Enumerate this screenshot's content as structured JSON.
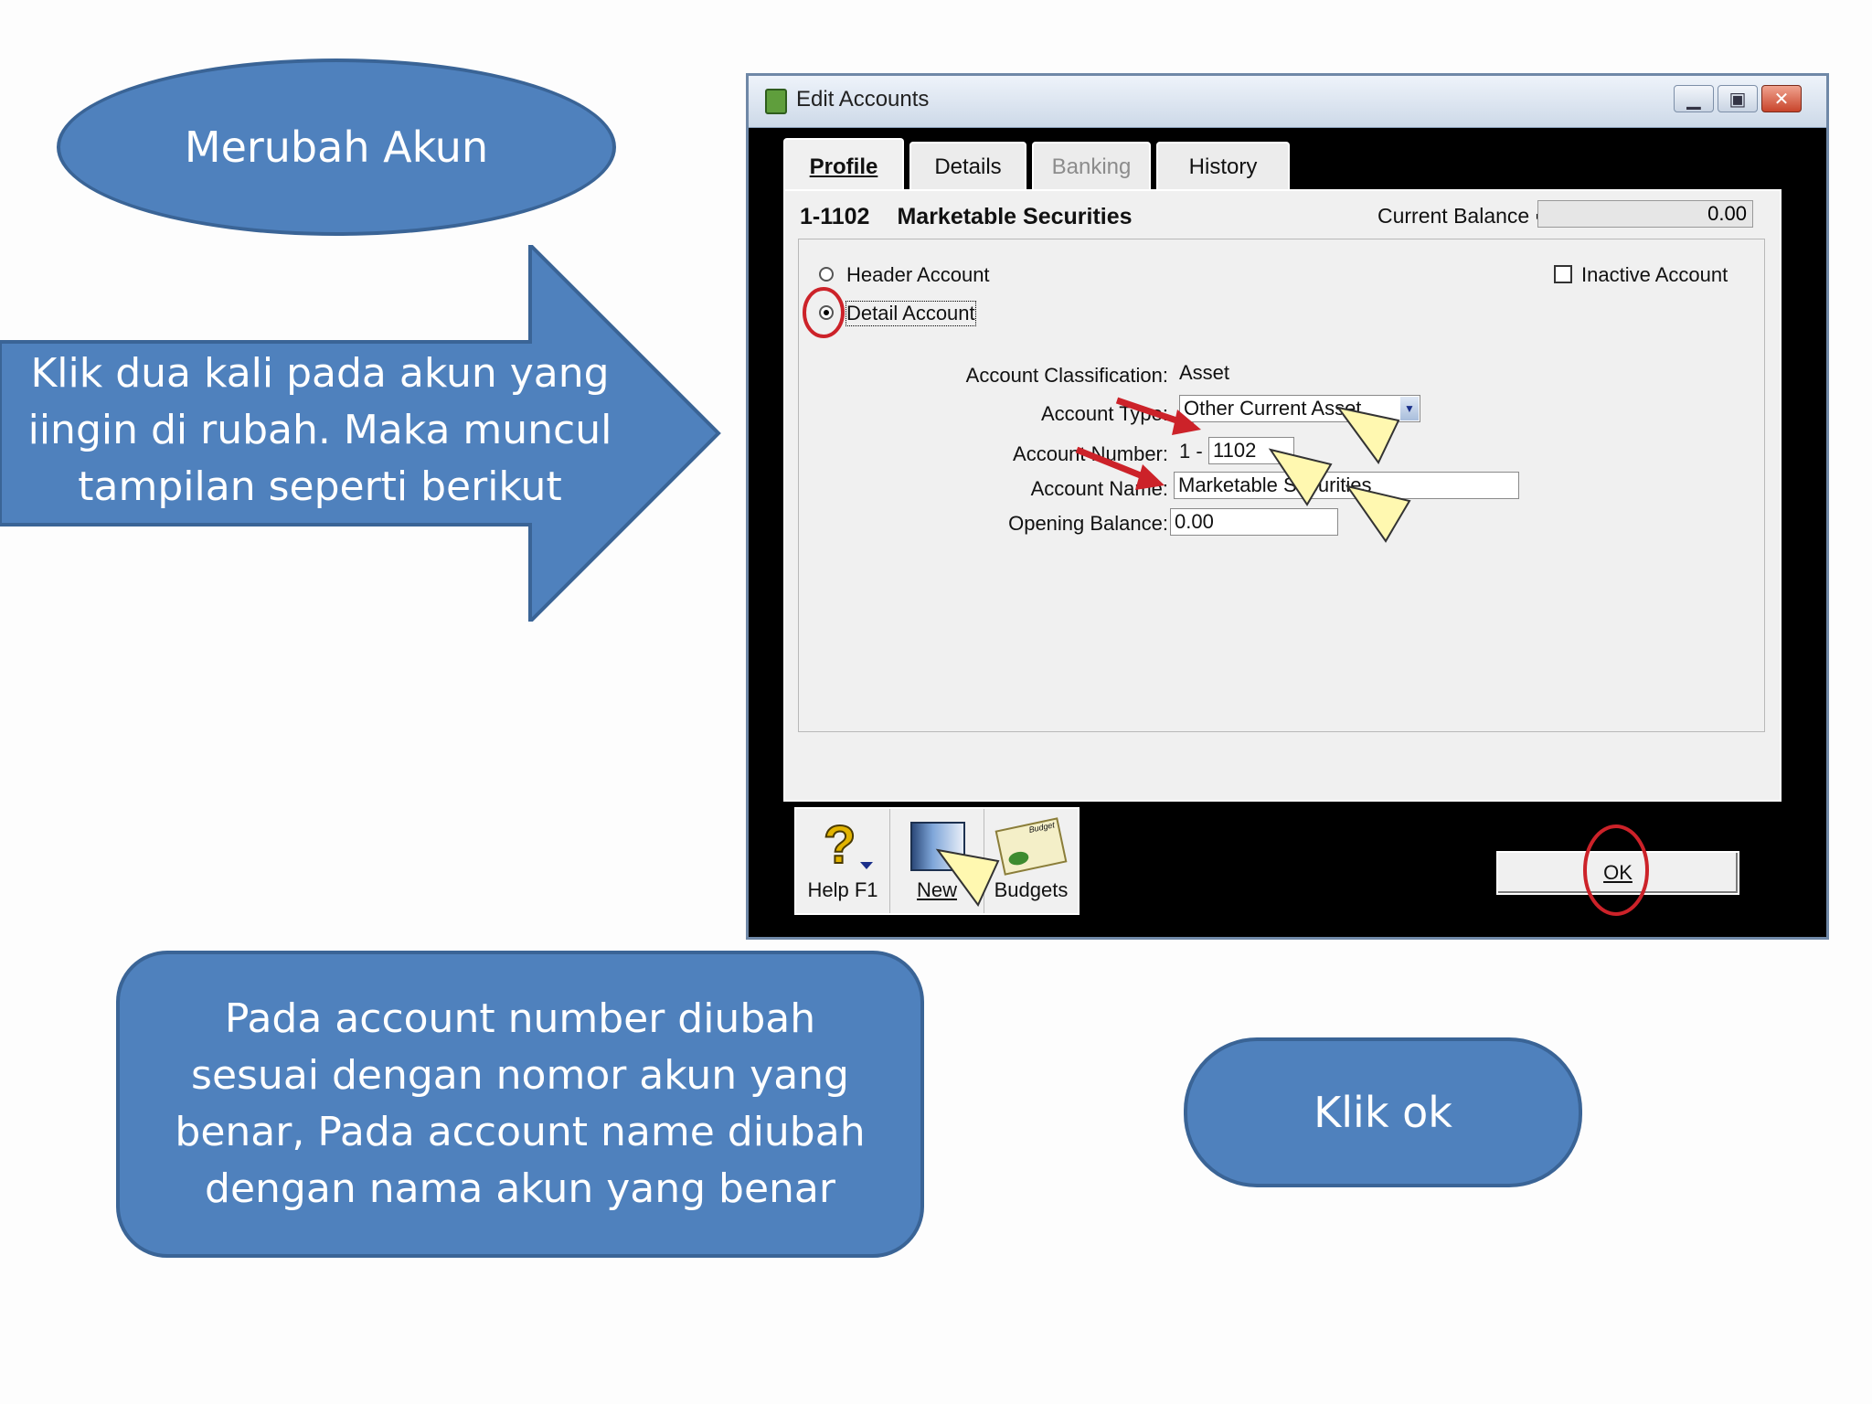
{
  "slide": {
    "title_ellipse": "Merubah Akun",
    "arrow_text": "Klik dua kali pada akun yang iingin di rubah. Maka muncul tampilan seperti berikut",
    "bottom_box": "Pada account number diubah sesuai dengan nomor akun yang benar, Pada account name diubah dengan nama akun yang benar",
    "ok_box": "Klik ok"
  },
  "window": {
    "title": "Edit Accounts",
    "tabs": [
      {
        "label": "Profile",
        "state": "active"
      },
      {
        "label": "Details",
        "state": "normal"
      },
      {
        "label": "Banking",
        "state": "disabled"
      },
      {
        "label": "History",
        "state": "normal"
      }
    ],
    "account_code": "1-1102",
    "account_title": "Marketable Securities",
    "current_balance_label": "Current Balance ➪:",
    "current_balance_value": "0.00",
    "header_account_label": "Header Account",
    "detail_account_label": "Detail Account",
    "inactive_account_label": "Inactive Account",
    "classification_label": "Account Classification:",
    "classification_value": "Asset",
    "type_label": "Account Type:",
    "type_value": "Other Current Asset",
    "number_label": "Account Number:",
    "number_prefix": "1 -",
    "number_value": "1102",
    "name_label": "Account Name:",
    "name_value": "Marketable Securities",
    "opening_label": "Opening Balance:",
    "opening_value": "0.00",
    "toolbar": {
      "help": "Help F1",
      "new": "New",
      "budgets": "Budgets",
      "budget_card_text": "Budget"
    },
    "ok_label": "OK"
  },
  "colors": {
    "callout_fill": "#4f81bd",
    "callout_border": "#3a6496",
    "annotation_red": "#cc2229",
    "pointer_yellow": "#fff8b0"
  }
}
